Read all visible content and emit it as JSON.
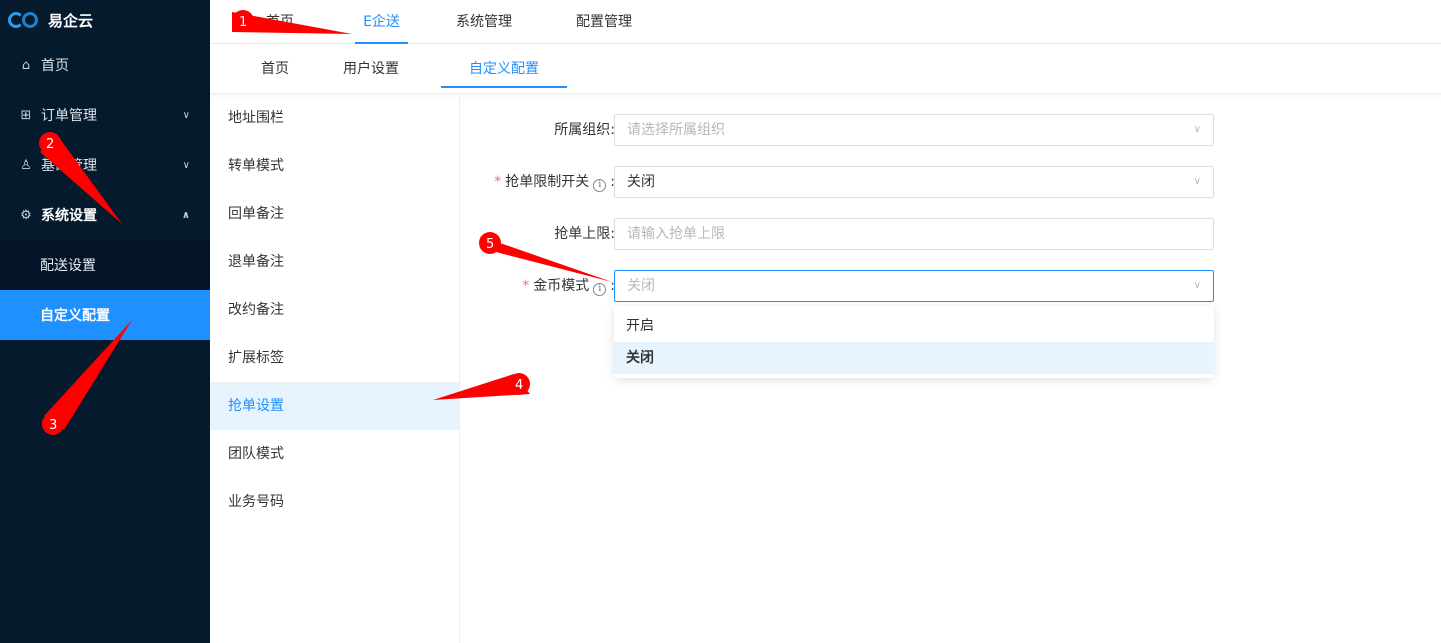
{
  "app": {
    "name": "易企云"
  },
  "sidebar": {
    "items": [
      {
        "label": "首页",
        "icon": "bank-icon"
      },
      {
        "label": "订单管理",
        "icon": "grid-icon"
      },
      {
        "label": "基础管理",
        "icon": "users-icon"
      },
      {
        "label": "系统设置",
        "icon": "gear-icon",
        "expanded": true
      }
    ],
    "subitems": [
      {
        "label": "配送设置",
        "active": false
      },
      {
        "label": "自定义配置",
        "active": true
      }
    ]
  },
  "topnav": {
    "tabs": [
      {
        "label": "首页",
        "active": false
      },
      {
        "label": "E企送",
        "active": true
      },
      {
        "label": "系统管理",
        "active": false
      },
      {
        "label": "配置管理",
        "active": false
      }
    ]
  },
  "subnav": {
    "tabs": [
      {
        "label": "首页",
        "active": false
      },
      {
        "label": "用户设置",
        "active": false
      },
      {
        "label": "自定义配置",
        "active": true
      }
    ]
  },
  "leftlist": {
    "items": [
      "地址围栏",
      "转单模式",
      "回单备注",
      "退单备注",
      "改约备注",
      "扩展标签",
      "抢单设置",
      "团队模式",
      "业务号码"
    ],
    "active_index": 6
  },
  "form": {
    "org": {
      "label": "所属组织",
      "placeholder": "请选择所属组织"
    },
    "grab_switch": {
      "label": "抢单限制开关",
      "value": "关闭",
      "required": true
    },
    "grab_limit": {
      "label": "抢单上限",
      "placeholder": "请输入抢单上限"
    },
    "coin_mode": {
      "label": "金币模式",
      "placeholder": "关闭",
      "required": true
    },
    "colon": ":",
    "info_glyph": "i"
  },
  "dropdown": {
    "options": [
      {
        "label": "开启",
        "selected": false
      },
      {
        "label": "关闭",
        "selected": true
      }
    ]
  },
  "annotations": [
    "1",
    "2",
    "3",
    "4",
    "5"
  ],
  "colors": {
    "accent": "#1e90ff",
    "sidebar_bg": "#061a2e",
    "annotation_red": "#ff0000"
  }
}
